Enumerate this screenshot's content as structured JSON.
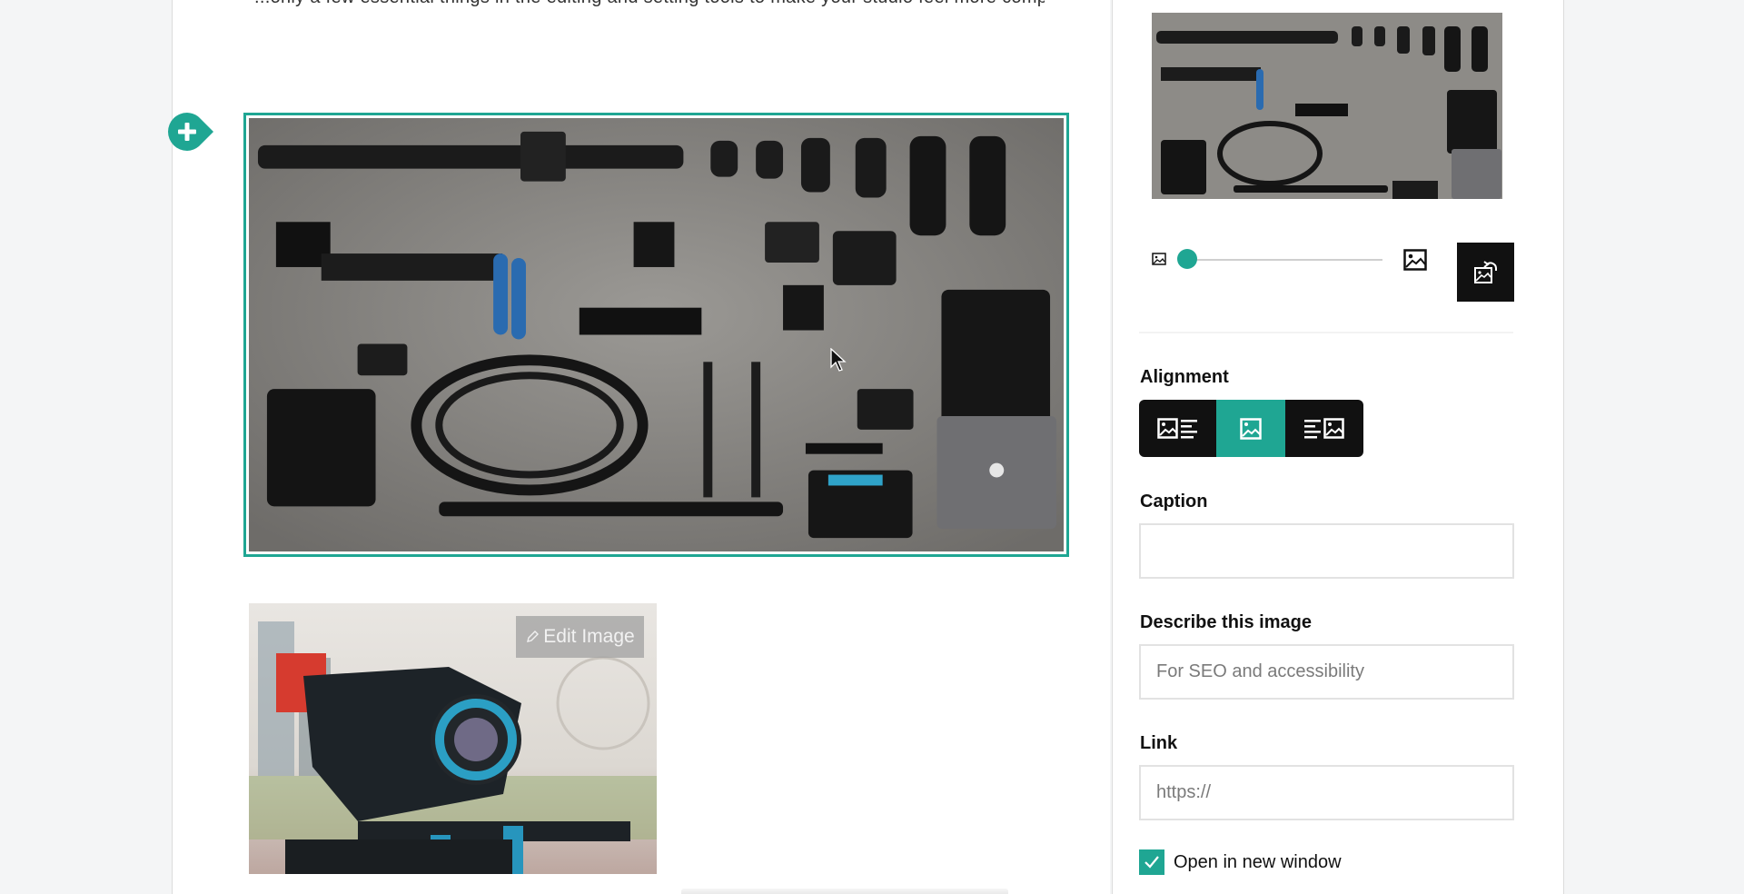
{
  "editor": {
    "top_text_partial": "...only a few essential things in the editing and setting tools to make your studio feel more complete and professional...",
    "selected_image": {
      "alt": "Flat lay of camera and video production gear on concrete surface",
      "selected": true
    },
    "add_block_button": {
      "icon": "plus-icon"
    },
    "second_image": {
      "alt": "Cinema camera rig with blue follow focus in front of city skyline",
      "edit_label": "Edit Image",
      "edit_icon": "pencil-icon"
    }
  },
  "panel": {
    "thumbnail_alt": "Camera gear thumbnail",
    "size_slider": {
      "min_icon": "small-image-icon",
      "max_icon": "large-image-icon",
      "value_percent": 0
    },
    "replace_button": {
      "icon": "replace-image-icon"
    },
    "alignment": {
      "label": "Alignment",
      "options": [
        {
          "id": "left",
          "icon": "align-image-left-icon",
          "active": false
        },
        {
          "id": "center",
          "icon": "align-image-center-icon",
          "active": true
        },
        {
          "id": "right",
          "icon": "align-image-right-icon",
          "active": false
        }
      ]
    },
    "caption": {
      "label": "Caption",
      "value": "",
      "placeholder": ""
    },
    "description": {
      "label": "Describe this image",
      "value": "",
      "placeholder": "For SEO and accessibility"
    },
    "link": {
      "label": "Link",
      "value": "",
      "placeholder": "https://"
    },
    "open_new_window": {
      "label": "Open in new window",
      "checked": true
    }
  },
  "colors": {
    "accent": "#1fa693",
    "dark_button": "#111111",
    "background": "#f4f5f6"
  }
}
